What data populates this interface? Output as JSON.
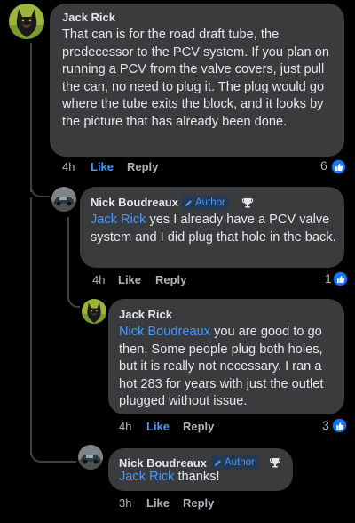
{
  "comments": [
    {
      "author": "Jack Rick",
      "text": "That can is for the road draft tube, the predecessor to the PCV system.  If you plan on running a PCV from the valve covers, just pull the can, no need to plug it.  The plug would go where the tube exits the block, and it looks by the picture that has already been done.",
      "time": "4h",
      "like_label": "Like",
      "reply_label": "Reply",
      "reaction_count": "6"
    },
    {
      "author": "Nick Boudreaux",
      "author_badge": "Author",
      "mention": "Jack Rick",
      "text": " yes I already have a PCV valve system and I did plug that hole in the back.",
      "time": "4h",
      "like_label": "Like",
      "reply_label": "Reply",
      "reaction_count": "1"
    },
    {
      "author": "Jack Rick",
      "mention": "Nick Boudreaux",
      "text": " you are good to go then.  Some people plug both holes, but it is really not necessary.  I ran a hot 283 for years with just the outlet plugged without issue.",
      "time": "4h",
      "like_label": "Like",
      "reply_label": "Reply",
      "reaction_count": "3"
    },
    {
      "author": "Nick Boudreaux",
      "author_badge": "Author",
      "mention": "Jack Rick",
      "text": " thanks!",
      "time": "3h",
      "like_label": "Like",
      "reply_label": "Reply"
    }
  ],
  "colors": {
    "background": "#000000",
    "bubble": "#3a3b3c",
    "mention": "#4599ff",
    "like_active": "#4599ff",
    "secondary_text": "#b0b3b8",
    "reaction_blue": "#1877f2"
  },
  "icons": [
    "jack-rick-avatar",
    "nick-boudreaux-avatar",
    "pencil-icon",
    "top-contributor-badge-icon",
    "like-reaction-icon"
  ]
}
